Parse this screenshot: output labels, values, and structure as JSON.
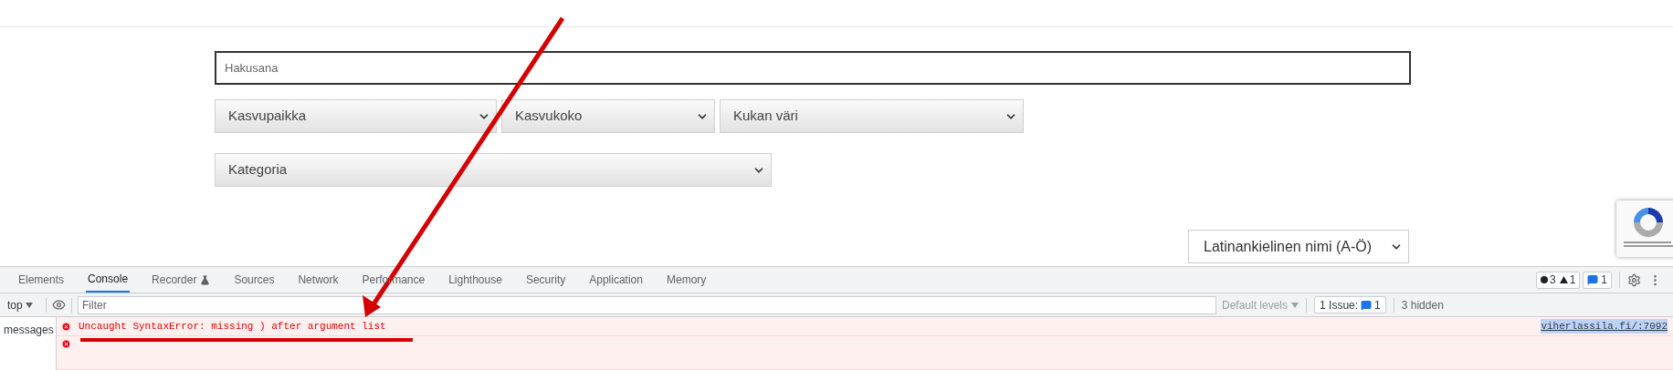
{
  "search": {
    "placeholder": "Hakusana"
  },
  "filters": [
    {
      "label": "Kasvupaikka"
    },
    {
      "label": "Kasvukoko"
    },
    {
      "label": "Kukan väri"
    }
  ],
  "category": {
    "label": "Kategoria"
  },
  "sort": {
    "label": "Latinankielinen nimi (A-Ö)"
  },
  "recaptcha": {
    "kind": "badge"
  },
  "devtools": {
    "tabs": [
      {
        "label": "Elements",
        "selected": false
      },
      {
        "label": "Console",
        "selected": true
      },
      {
        "label": "Recorder",
        "selected": false
      },
      {
        "label": "Sources",
        "selected": false
      },
      {
        "label": "Network",
        "selected": false
      },
      {
        "label": "Performance",
        "selected": false
      },
      {
        "label": "Lighthouse",
        "selected": false
      },
      {
        "label": "Security",
        "selected": false
      },
      {
        "label": "Application",
        "selected": false
      },
      {
        "label": "Memory",
        "selected": false
      }
    ],
    "counts": {
      "errors": "3",
      "warnings": "1",
      "messages": "1"
    },
    "context": "top",
    "filter_placeholder": "Filter",
    "levels": "Default levels",
    "issues_label": "1 Issue:",
    "issues_count": "1",
    "hidden": "3 hidden",
    "sidebar_item": "messages",
    "messages": [
      {
        "kind": "error",
        "text": "Uncaught SyntaxError: missing ) after argument list",
        "source": "viherlassila.fi/:7092"
      },
      {
        "kind": "error"
      }
    ]
  }
}
